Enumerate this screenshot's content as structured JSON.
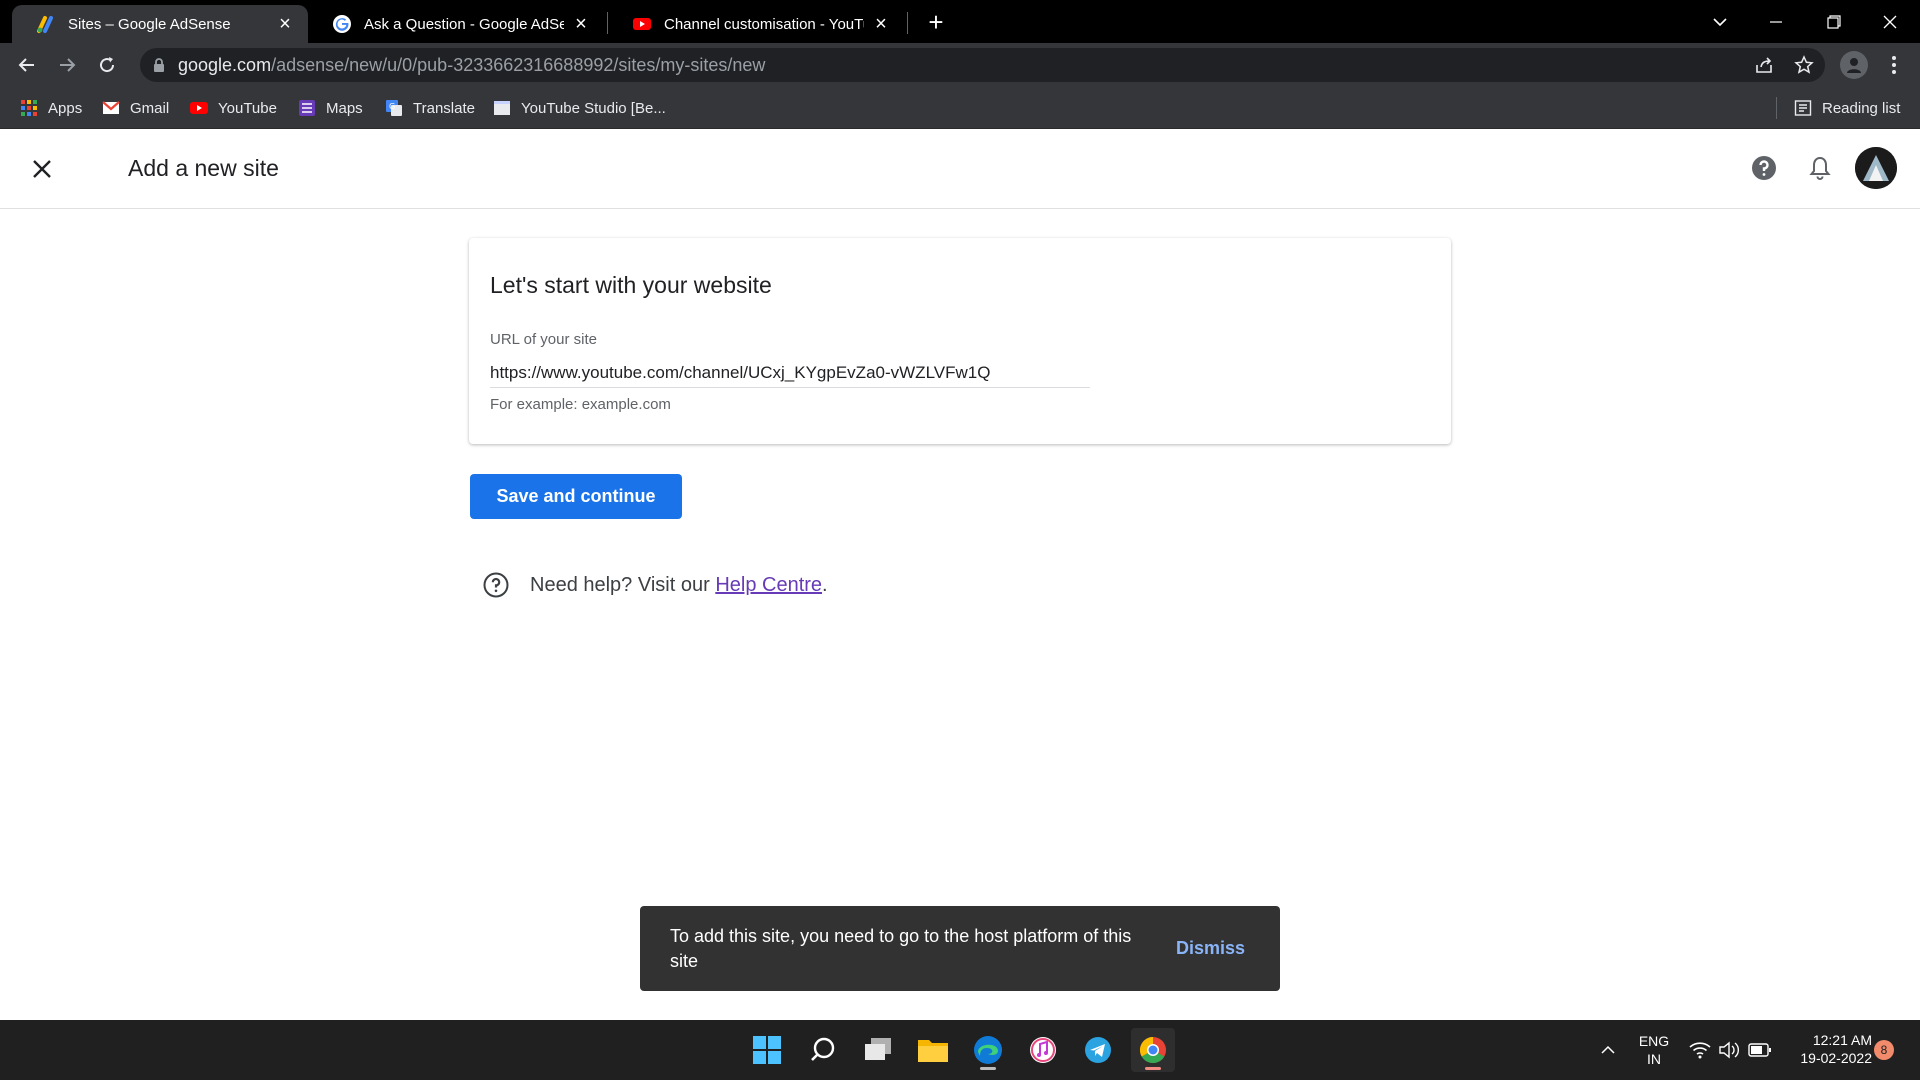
{
  "browser": {
    "tabs": [
      {
        "title": "Sites – Google AdSense",
        "favicon": "adsense-icon",
        "active": true
      },
      {
        "title": "Ask a Question - Google AdSense",
        "favicon": "google-icon",
        "active": false
      },
      {
        "title": "Channel customisation - YouTube",
        "favicon": "youtube-icon",
        "active": false
      }
    ],
    "address": {
      "host": "google.com",
      "path": "/adsense/new/u/0/pub-3233662316688992/sites/my-sites/new"
    },
    "bookmarks": [
      {
        "label": "Apps",
        "icon": "apps-grid-icon"
      },
      {
        "label": "Gmail",
        "icon": "gmail-icon"
      },
      {
        "label": "YouTube",
        "icon": "youtube-icon"
      },
      {
        "label": "Maps",
        "icon": "maps-icon"
      },
      {
        "label": "Translate",
        "icon": "translate-icon"
      },
      {
        "label": "YouTube Studio [Be...",
        "icon": "page-icon"
      }
    ],
    "reading_list": "Reading list"
  },
  "header": {
    "title": "Add a new site"
  },
  "form": {
    "heading": "Let's start with your website",
    "url_label": "URL of your site",
    "url_value": "https://www.youtube.com/channel/UCxj_KYgpEvZa0-vWZLVFw1Q",
    "hint": "For example: example.com",
    "save_label": "Save and continue"
  },
  "help": {
    "prefix": "Need help? Visit our ",
    "link": "Help Centre",
    "suffix": "."
  },
  "snackbar": {
    "message": "To add this site, you need to go to the host platform of this site",
    "action": "Dismiss"
  },
  "taskbar": {
    "lang_line1": "ENG",
    "lang_line2": "IN",
    "time": "12:21 AM",
    "date": "19-02-2022",
    "notifications": "8"
  },
  "colors": {
    "primary": "#1a73e8",
    "link": "#673ab7",
    "snackbar_action": "#8ab4f8"
  }
}
